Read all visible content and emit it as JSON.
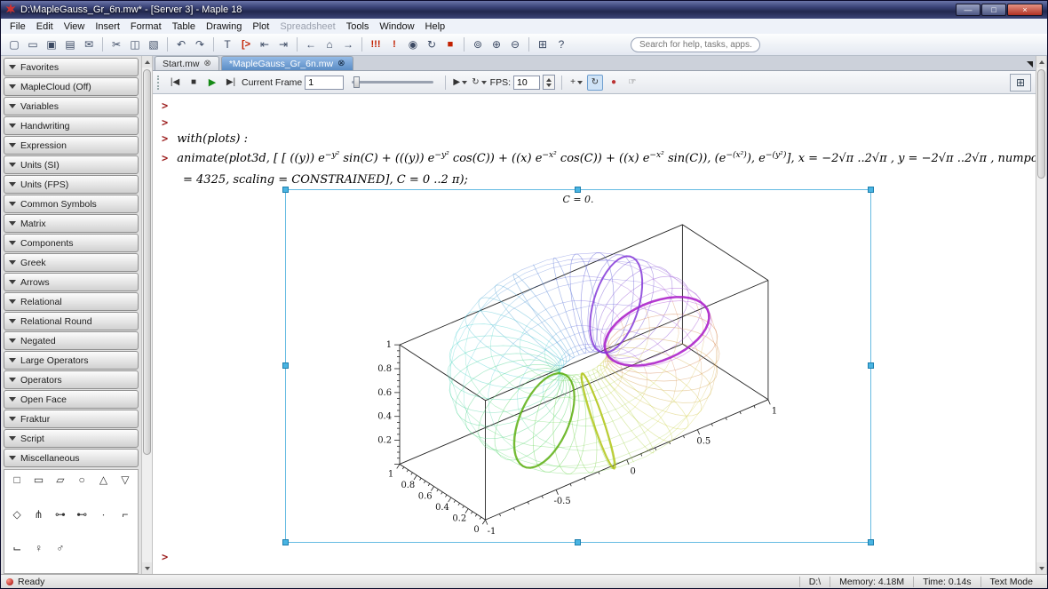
{
  "colors": {
    "titlebar": "#2c3566",
    "active_tab": "#5a8cc5",
    "prompt_red": "#9b1c1c",
    "selection_blue": "#49b4e2",
    "execute_red": "#c22000"
  },
  "window": {
    "title": "D:\\MapleGauss_Gr_6n.mw* - [Server 3] - Maple 18",
    "buttons": {
      "minimize": "—",
      "maximize": "□",
      "close": "×"
    }
  },
  "menu": {
    "items": [
      "File",
      "Edit",
      "View",
      "Insert",
      "Format",
      "Table",
      "Drawing",
      "Plot",
      "Spreadsheet",
      "Tools",
      "Window",
      "Help"
    ]
  },
  "toolbar": {
    "search_placeholder": "Search for help, tasks, apps...",
    "icons": [
      {
        "name": "new-document",
        "glyph": "▢"
      },
      {
        "name": "open-file",
        "glyph": "▭"
      },
      {
        "name": "save",
        "glyph": "▣"
      },
      {
        "name": "print",
        "glyph": "▤"
      },
      {
        "name": "mail",
        "glyph": "✉"
      },
      {
        "name": "cut",
        "glyph": "✂"
      },
      {
        "name": "copy",
        "glyph": "◫"
      },
      {
        "name": "paste",
        "glyph": "▧"
      },
      {
        "name": "undo",
        "glyph": "↶"
      },
      {
        "name": "redo",
        "glyph": "↷"
      },
      {
        "name": "insert-text",
        "glyph": "T"
      },
      {
        "name": "insert-maple-input",
        "glyph": "[>"
      },
      {
        "name": "outdent",
        "glyph": "⇤"
      },
      {
        "name": "indent",
        "glyph": "⇥"
      },
      {
        "name": "back",
        "glyph": "←"
      },
      {
        "name": "home",
        "glyph": "⌂"
      },
      {
        "name": "forward",
        "glyph": "→"
      },
      {
        "name": "execute-all",
        "glyph": "!!!"
      },
      {
        "name": "execute",
        "glyph": "!"
      },
      {
        "name": "debug",
        "glyph": "◉"
      },
      {
        "name": "restart-kernel",
        "glyph": "↻"
      },
      {
        "name": "interrupt",
        "glyph": "■"
      },
      {
        "name": "zoom-reset",
        "glyph": "⊚"
      },
      {
        "name": "zoom-in",
        "glyph": "⊕"
      },
      {
        "name": "zoom-out",
        "glyph": "⊖"
      },
      {
        "name": "table-grid",
        "glyph": "⊞"
      },
      {
        "name": "help",
        "glyph": "?"
      }
    ]
  },
  "tabs": [
    {
      "label": "Start.mw",
      "close": "⊗"
    },
    {
      "label": "*MapleGauss_Gr_6n.mw",
      "close": "⊗"
    }
  ],
  "animation": {
    "to_start": "|◀",
    "stop": "■",
    "play": "▶",
    "to_end": "▶|",
    "current_frame_label": "Current Frame",
    "frame_value": "1",
    "direction": "▶",
    "loop": "↻",
    "fps_label": "FPS:",
    "fps_value": "10",
    "probe": "+",
    "rotate": "↻",
    "scale": "●",
    "pan": "☞",
    "grid": "⊞"
  },
  "palette": {
    "sections": [
      "Favorites",
      "MapleCloud (Off)",
      "Variables",
      "Handwriting",
      "Expression",
      "Units (SI)",
      "Units (FPS)",
      "Common Symbols",
      "Matrix",
      "Components",
      "Greek",
      "Arrows",
      "Relational",
      "Relational Round",
      "Negated",
      "Large Operators",
      "Operators",
      "Open Face",
      "Fraktur",
      "Script",
      "Miscellaneous"
    ],
    "misc_symbols": [
      "□",
      "▭",
      "▱",
      "○",
      "△",
      "▽",
      "◇",
      "⋔",
      "⊶",
      "⊷",
      "∙",
      "⌐",
      "⌙",
      "♀",
      "♂"
    ]
  },
  "worksheet": {
    "prompt": ">",
    "with_line": "with(plots) :",
    "animate_tokens": [
      {
        "v": "animate(plot3d, [ [ ((y)) e"
      },
      {
        "v": "−y²",
        "s": 1
      },
      {
        "v": " sin(C) + (((y)) e"
      },
      {
        "v": "−y²",
        "s": 1
      },
      {
        "v": " cos(C)) + ((x) e"
      },
      {
        "v": "−x²",
        "s": 1
      },
      {
        "v": " cos(C)) + ((x) e"
      },
      {
        "v": "−x²",
        "s": 1
      },
      {
        "v": " sin(C)), (e"
      },
      {
        "v": "−(x²)",
        "s": 1
      },
      {
        "v": "), e"
      },
      {
        "v": "−(y²)",
        "s": 1
      },
      {
        "v": "], x = −2√π ..2√π , y = −2√π ..2√π , numpoints"
      }
    ],
    "animate_line2": [
      {
        "v": "= 4325, scaling = CONSTRAINED], C = 0 ..2 π);"
      }
    ],
    "plot": {
      "title": "C = 0.",
      "x_tick_labels": [
        "-1",
        "-0.5",
        "0",
        "0.5",
        "1"
      ],
      "y_tick_labels": [
        "1",
        "0.8",
        "0.6",
        "0.4",
        "0.2",
        "0"
      ],
      "z_tick_labels": [
        "0.2",
        "0.4",
        "0.6",
        "0.8",
        "1"
      ]
    }
  },
  "status": {
    "ready_label": "Ready",
    "items": [
      "D:\\",
      "Memory: 4.18M",
      "Time: 0.14s",
      "Text Mode"
    ]
  }
}
